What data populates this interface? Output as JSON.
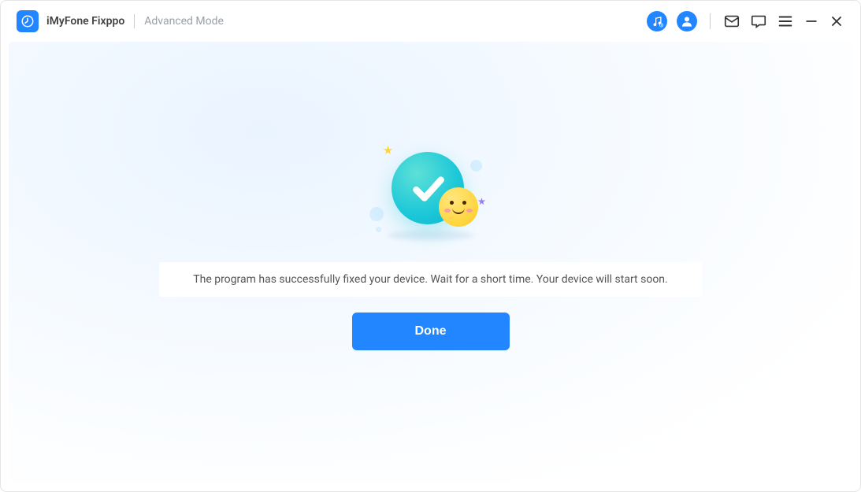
{
  "app": {
    "title": "iMyFone Fixppo",
    "mode": "Advanced Mode"
  },
  "icons": {
    "music": "music-icon",
    "account": "account-icon",
    "mail": "mail-icon",
    "chat": "chat-icon",
    "menu": "menu-icon",
    "minimize": "minimize-icon",
    "close": "close-icon"
  },
  "main": {
    "message": "The program has successfully fixed your device. Wait for a short time. Your device will start soon.",
    "done_label": "Done"
  }
}
